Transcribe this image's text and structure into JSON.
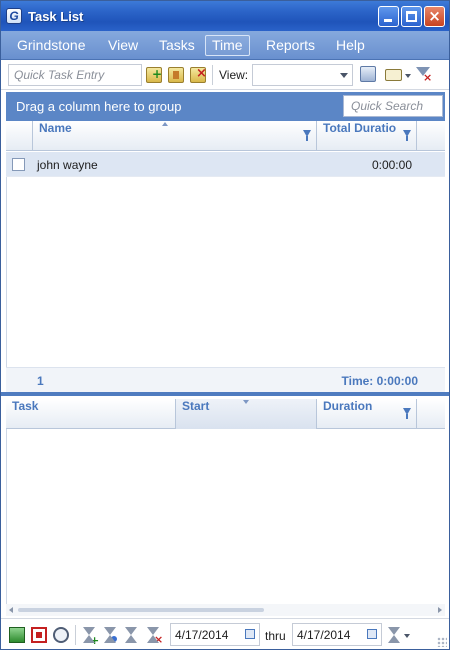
{
  "window": {
    "title": "Task List",
    "app_icon_letter": "G",
    "close_glyph": "×"
  },
  "menu": {
    "items": [
      "Grindstone",
      "View",
      "Tasks",
      "Time",
      "Reports",
      "Help"
    ],
    "active": "Time"
  },
  "toolbar": {
    "quick_task_placeholder": "Quick Task Entry",
    "view_label": "View:",
    "view_value": "",
    "icons": [
      "add-task-icon",
      "edit-task-icon",
      "delete-task-icon",
      "view-settings-icon",
      "columns-icon",
      "clear-filter-icon"
    ]
  },
  "group_panel": {
    "text": "Drag a column here to group",
    "search_placeholder": "Quick Search"
  },
  "task_grid": {
    "columns": [
      "Name",
      "Total Duratio"
    ],
    "rows": [
      {
        "checked": false,
        "name": "john wayne",
        "total_duration": "0:00:00"
      }
    ],
    "summary": {
      "count": "1",
      "time": "Time: 0:00:00"
    }
  },
  "time_grid": {
    "columns": [
      "Task",
      "Start",
      "Duration"
    ],
    "rows": []
  },
  "bottom_bar": {
    "date_from": "4/17/2014",
    "thru_label": "thru",
    "date_to": "4/17/2014",
    "icons": [
      "start-timer-icon",
      "stop-timer-icon",
      "alarm-icon",
      "add-time-icon",
      "edit-time-icon",
      "approve-time-icon",
      "delete-time-icon",
      "date-range-icon"
    ]
  },
  "colors": {
    "title_bar": "#2b64c8",
    "menu_bar": "#7aa0d8",
    "group_panel": "#5b86c6",
    "header_text": "#4a78bd",
    "selected_row": "#dde6f3"
  }
}
